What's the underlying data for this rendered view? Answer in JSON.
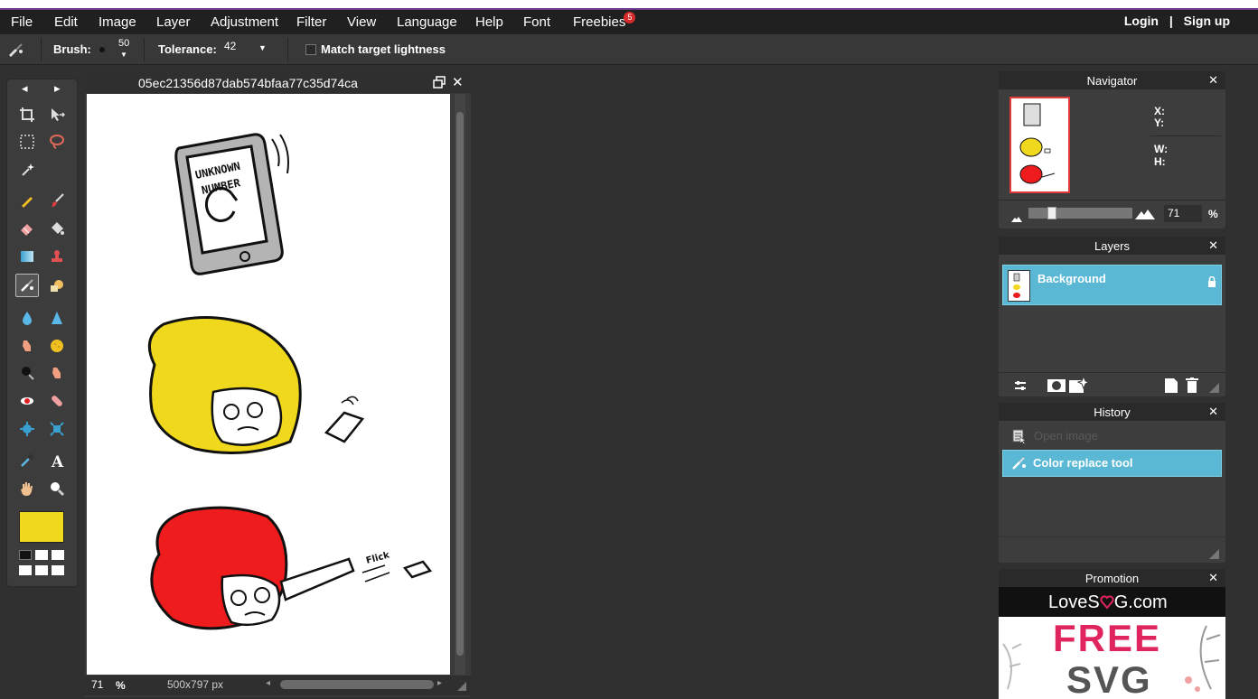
{
  "menu": {
    "items": [
      "File",
      "Edit",
      "Image",
      "Layer",
      "Adjustment",
      "Filter",
      "View",
      "Language",
      "Help",
      "Font",
      "Freebies"
    ],
    "freebies_badge": "5",
    "login": "Login",
    "separator": "|",
    "signup": "Sign up"
  },
  "options": {
    "brush_label": "Brush:",
    "brush_size": "50",
    "tolerance_label": "Tolerance:",
    "tolerance_value": "42",
    "match_label": "Match target lightness"
  },
  "toolbox": {
    "foreground_color": "#f0d91c",
    "prev_arrow": "◂",
    "next_arrow": "▸"
  },
  "document": {
    "title": "05ec21356d87dab574bfaa77c35d74ca",
    "zoom": "71",
    "zoom_unit": "%",
    "dimensions": "500x797 px",
    "comic": {
      "phone_text_line1": "UNKNOWN",
      "phone_text_line2": "NUMBER",
      "flick_text": "Flick"
    }
  },
  "navigator": {
    "title": "Navigator",
    "x_label": "X:",
    "y_label": "Y:",
    "w_label": "W:",
    "h_label": "H:",
    "zoom_value": "71",
    "zoom_unit": "%",
    "zoom_level": 0.2
  },
  "layers": {
    "title": "Layers",
    "items": [
      {
        "name": "Background"
      }
    ]
  },
  "history": {
    "title": "History",
    "items": [
      {
        "label": "Open image"
      },
      {
        "label": "Color replace tool"
      }
    ]
  },
  "promotion": {
    "title": "Promotion",
    "brand_left": "LoveS",
    "brand_right": "G.com",
    "line1": "FREE",
    "line2": "SVG"
  },
  "colors": {
    "accent": "#5ab8d4",
    "yellow": "#f0d91c",
    "red": "#ee1c1c",
    "promo_pink": "#e0245e"
  }
}
